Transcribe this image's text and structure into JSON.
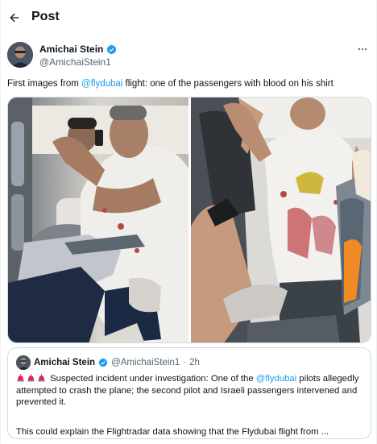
{
  "header": {
    "title": "Post"
  },
  "author": {
    "name": "Amichai Stein",
    "handle": "@AmichaiStein1",
    "verified": true
  },
  "tweet": {
    "text_before": "First images from ",
    "mention": "@flydubai",
    "text_after": " flight: one of the passengers with blood on his shirt"
  },
  "media": {
    "photos": [
      {
        "icon": "photo-passenger-on-phone"
      },
      {
        "icon": "photo-passenger-standing-bloody-shirt"
      }
    ]
  },
  "quote": {
    "name": "Amichai Stein",
    "handle": "@AmichaiStein1",
    "sep": "·",
    "time": "2h",
    "text_before": " Suspected incident under investigation: One of the ",
    "mention": "@flydubai",
    "text_after": " pilots allegedly attempted to crash the plane; the second pilot and Israeli passengers intervened and prevented it.",
    "text2": "This could explain the Flightradar data showing that the Flydubai flight from ..."
  },
  "colors": {
    "accent": "#1d9bf0",
    "muted": "#536471",
    "border": "#cfd9de",
    "siren": "#e0245e"
  }
}
